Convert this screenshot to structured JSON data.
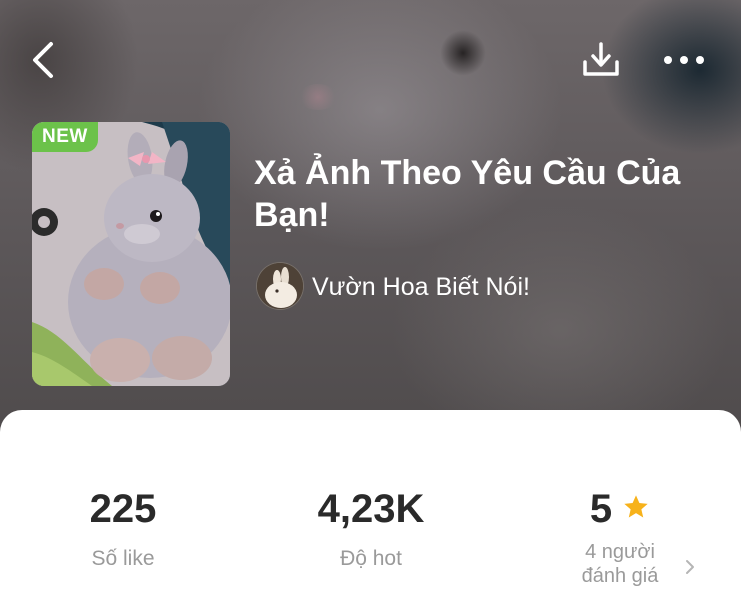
{
  "header": {
    "back_icon": "chevron-left-icon",
    "download_icon": "download-icon",
    "more_icon": "more-horizontal-icon"
  },
  "album": {
    "badge": "NEW",
    "title": "Xả Ảnh Theo Yêu Cầu Của Bạn!",
    "author": "Vườn Hoa Biết Nói!",
    "badge_color": "#6cc24a"
  },
  "stats": {
    "likes": {
      "value": "225",
      "label": "Số like"
    },
    "hot": {
      "value": "4,23K",
      "label": "Độ hot"
    },
    "rating": {
      "value": "5",
      "label_line1": "4 người",
      "label_line2": "đánh giá",
      "star_color": "#f7b21b"
    }
  }
}
